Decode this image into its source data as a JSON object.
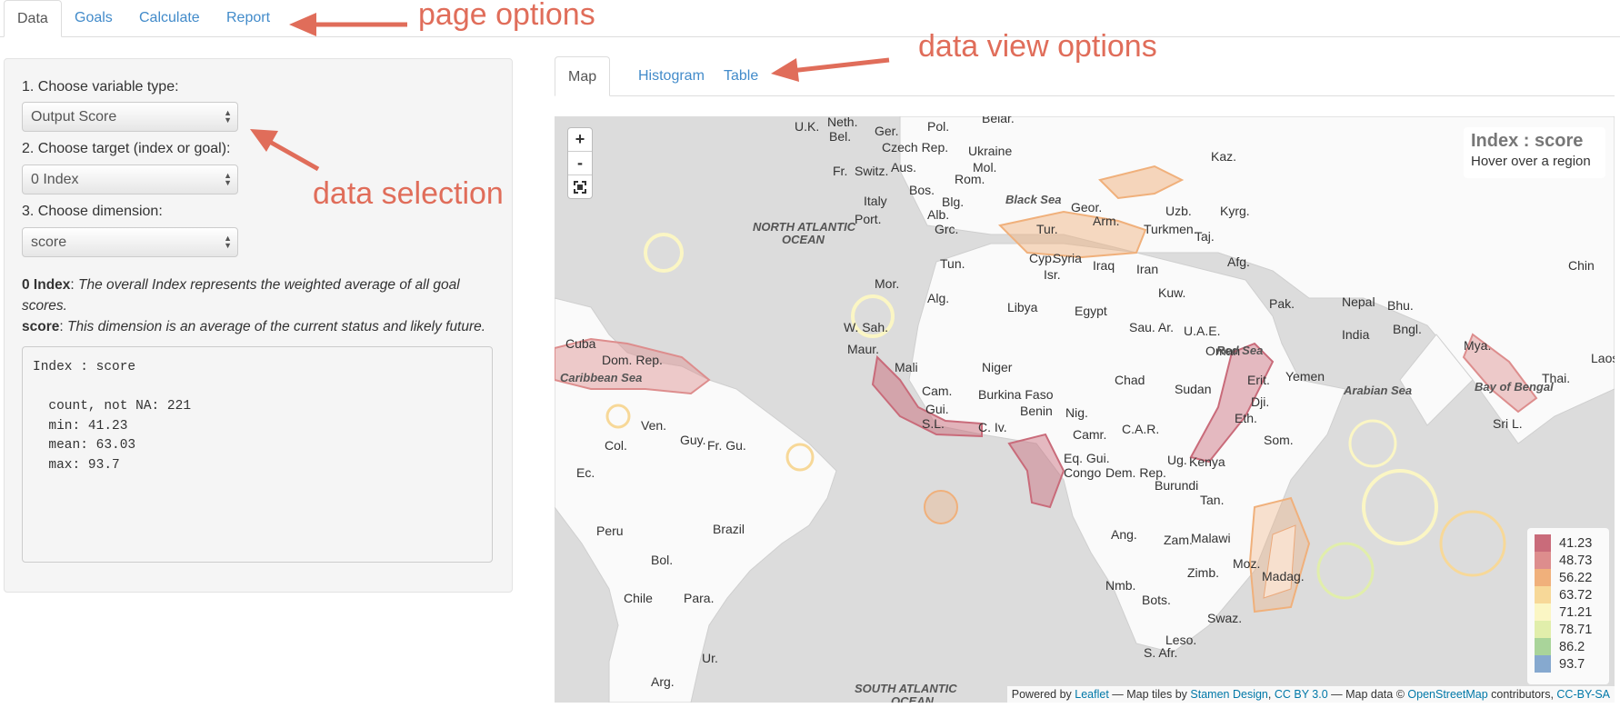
{
  "tabs": [
    "Data",
    "Goals",
    "Calculate",
    "Report"
  ],
  "sidebar": {
    "step1_label": "1. Choose variable type:",
    "step1_value": "Output Score",
    "step2_label": "2. Choose target (index or goal):",
    "step2_value": "0 Index",
    "step3_label": "3. Choose dimension:",
    "step3_value": "score",
    "desc1_key": "0 Index",
    "desc1_text": "The overall Index represents the weighted average of all goal scores.",
    "desc2_key": "score",
    "desc2_text": "This dimension is an average of the current status and likely future.",
    "summary": {
      "title": "Index : score",
      "count": "count, not NA: 221",
      "min": "min: 41.23",
      "mean": "mean: 63.03",
      "max": "max: 93.7"
    }
  },
  "annotations": {
    "page_options": "page options",
    "data_view_options": "data view options",
    "data_selection": "data selection"
  },
  "subtabs": [
    "Map",
    "Histogram",
    "Table"
  ],
  "map": {
    "zoom_in": "+",
    "zoom_out": "-",
    "info_title": "Index : score",
    "info_sub": "Hover over a region",
    "legend": [
      {
        "value": "41.23",
        "color": "#c96b7a"
      },
      {
        "value": "48.73",
        "color": "#dd8d8d"
      },
      {
        "value": "56.22",
        "color": "#f0b07b"
      },
      {
        "value": "63.72",
        "color": "#f7d898"
      },
      {
        "value": "71.21",
        "color": "#fbf6c4"
      },
      {
        "value": "78.71",
        "color": "#e1eeab"
      },
      {
        "value": "86.2",
        "color": "#a9d49a"
      },
      {
        "value": "93.7",
        "color": "#86a9cf"
      }
    ],
    "attribution": {
      "powered": "Powered by",
      "leaflet": "Leaflet",
      "tiles": " — Map tiles by",
      "stamen": "Stamen Design",
      "cc": "CC BY 3.0",
      "mapdata": " — Map data ©",
      "osm": "OpenStreetMap",
      "contrib": "contributors,",
      "ccsa": "CC-BY-SA"
    },
    "labels": [
      "U.K.",
      "Neth.",
      "Bel.",
      "Ger.",
      "Pol.",
      "Belar.",
      "Ukraine",
      "Czech Rep.",
      "Aus.",
      "Mol.",
      "Rom.",
      "Fr.",
      "Switz.",
      "Italy",
      "Bos.",
      "Blg.",
      "Black Sea",
      "Geor.",
      "Arm.",
      "Kaz.",
      "Uzb.",
      "Kyrg.",
      "Turkmen.",
      "Taj.",
      "NORTH ATLANTIC",
      "OCEAN",
      "Port.",
      "Alb.",
      "Grc.",
      "Tur.",
      "Cyp.",
      "Syria",
      "Isr.",
      "Iraq",
      "Iran",
      "Afg.",
      "Chin",
      "Tun.",
      "Mor.",
      "Alg.",
      "Libya",
      "Egypt",
      "Kuw.",
      "Pak.",
      "Nepal",
      "Bhu.",
      "W. Sah.",
      "Sau. Ar.",
      "U.A.E.",
      "Oman",
      "India",
      "Bngl.",
      "Mya.",
      "Laos",
      "Maur.",
      "Mali",
      "Niger",
      "Red Sea",
      "Yemen",
      "Cuba",
      "Dom. Rep.",
      "Caribbean Sea",
      "Chad",
      "Sudan",
      "Erit.",
      "Dji.",
      "Arabian Sea",
      "Bay of Bengal",
      "Thai.",
      "Cam.",
      "Burkina Faso",
      "Benin",
      "Nig.",
      "Gui.",
      "S.L.",
      "C. Iv.",
      "Ven.",
      "Guy.",
      "Fr. Gu.",
      "Camr.",
      "C.A.R.",
      "Eth.",
      "Sri L.",
      "Eq. Gui.",
      "Som.",
      "Col.",
      "Ug.",
      "Kenya",
      "Ec.",
      "Congo",
      "Dem. Rep.",
      "Burundi",
      "Tan.",
      "Peru",
      "Brazil",
      "Ang.",
      "Zam.",
      "Malawi",
      "Moz.",
      "Bol.",
      "Zimb.",
      "Madag.",
      "Chile",
      "Para.",
      "Nmb.",
      "Bots.",
      "Swaz.",
      "Leso.",
      "S. Afr.",
      "Ur.",
      "Arg.",
      "SOUTH ATLANTIC",
      "OCEAN"
    ]
  }
}
